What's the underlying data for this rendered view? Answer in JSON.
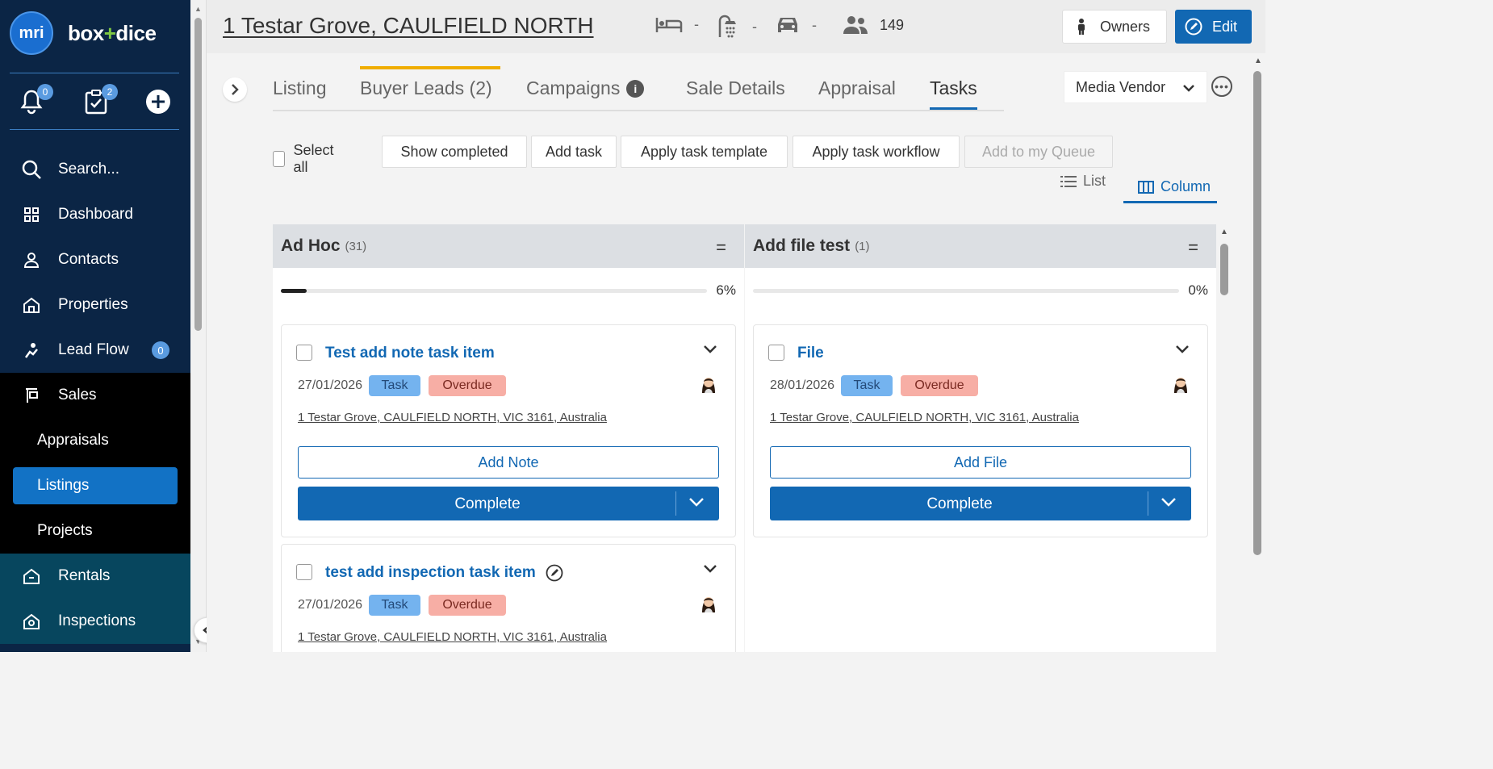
{
  "brand": {
    "logo_text": "mri",
    "name_left": "box",
    "name_plus": "+",
    "name_right": "dice"
  },
  "sidebar": {
    "notifications_count": "0",
    "tasks_count": "2",
    "items": [
      {
        "label": "Search..."
      },
      {
        "label": "Dashboard"
      },
      {
        "label": "Contacts"
      },
      {
        "label": "Properties"
      },
      {
        "label": "Lead Flow",
        "badge": "0"
      },
      {
        "label": "Sales"
      },
      {
        "label": "Appraisals"
      },
      {
        "label": "Listings"
      },
      {
        "label": "Projects"
      },
      {
        "label": "Rentals"
      },
      {
        "label": "Inspections"
      }
    ]
  },
  "header": {
    "title": "1 Testar Grove, CAULFIELD NORTH",
    "bedrooms": "-",
    "bathrooms": "-",
    "cars": "-",
    "people": "149",
    "owners_label": "Owners",
    "edit_label": "Edit"
  },
  "tabs": [
    {
      "label": "Listing"
    },
    {
      "label": "Buyer Leads (2)"
    },
    {
      "label": "Campaigns",
      "info": "i"
    },
    {
      "label": "Sale Details"
    },
    {
      "label": "Appraisal"
    },
    {
      "label": "Tasks"
    }
  ],
  "media_vendor": {
    "value": "Media Vendor"
  },
  "toolbar": {
    "select_all": "Select all",
    "show_completed": "Show completed",
    "add_task": "Add task",
    "apply_template": "Apply task template",
    "apply_workflow": "Apply task workflow",
    "add_queue": "Add to my Queue"
  },
  "view": {
    "list": "List",
    "column": "Column"
  },
  "columns": [
    {
      "title": "Ad Hoc",
      "count": "(31)",
      "menu": "=",
      "progress": 6,
      "progress_label": "6%",
      "cards": [
        {
          "title": "Test add note task item",
          "date": "27/01/2026",
          "type": "Task",
          "status": "Overdue",
          "address": "1 Testar Grove, CAULFIELD NORTH, VIC 3161, Australia",
          "action": "Add Note",
          "complete": "Complete"
        },
        {
          "title": "test add inspection task item",
          "date": "27/01/2026",
          "type": "Task",
          "status": "Overdue",
          "address": "1 Testar Grove, CAULFIELD NORTH, VIC 3161, Australia"
        }
      ]
    },
    {
      "title": "Add file test",
      "count": "(1)",
      "menu": "=",
      "progress": 0,
      "progress_label": "0%",
      "cards": [
        {
          "title": "File",
          "date": "28/01/2026",
          "type": "Task",
          "status": "Overdue",
          "address": "1 Testar Grove, CAULFIELD NORTH, VIC 3161, Australia",
          "action": "Add File",
          "complete": "Complete"
        }
      ]
    }
  ],
  "colors": {
    "primary": "#1268b3",
    "sidebar": "#0b2545",
    "accent_tab": "#f0ad00",
    "task_badge": "#74b3ef",
    "overdue_badge": "#f7aea5"
  }
}
